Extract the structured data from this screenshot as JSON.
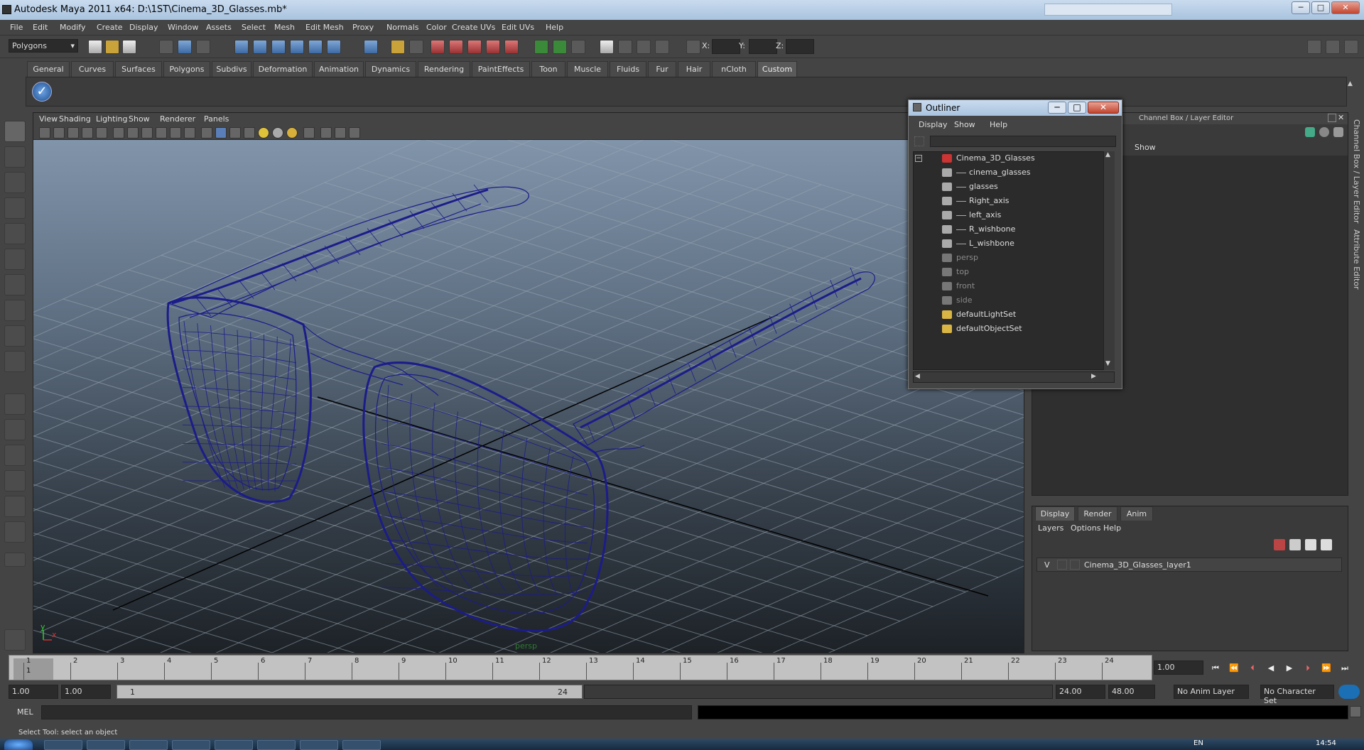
{
  "window": {
    "title": "Autodesk Maya 2011 x64: D:\\1ST\\Cinema_3D_Glasses.mb*",
    "minimize": "─",
    "maximize": "□",
    "close": "✕"
  },
  "menubar": [
    "File",
    "Edit",
    "Modify",
    "Create",
    "Display",
    "Window",
    "Assets",
    "Select",
    "Mesh",
    "Edit Mesh",
    "Proxy",
    "Normals",
    "Color",
    "Create UVs",
    "Edit UVs",
    "Help"
  ],
  "statusline": {
    "mode": "Polygons",
    "x_label": "X:",
    "y_label": "Y:",
    "z_label": "Z:"
  },
  "shelf_tabs": [
    "General",
    "Curves",
    "Surfaces",
    "Polygons",
    "Subdivs",
    "Deformation",
    "Animation",
    "Dynamics",
    "Rendering",
    "PaintEffects",
    "Toon",
    "Muscle",
    "Fluids",
    "Fur",
    "Hair",
    "nCloth",
    "Custom"
  ],
  "shelf_active": "Custom",
  "viewport": {
    "menu": [
      "View",
      "Shading",
      "Lighting",
      "Show",
      "Renderer",
      "Panels"
    ],
    "camera_label": "persp",
    "axis_y": "y",
    "axis_x": "x",
    "wire_color": "#1c1c8a"
  },
  "outliner": {
    "title": "Outliner",
    "menu": [
      "Display",
      "Show",
      "Help"
    ],
    "items": [
      {
        "label": "Cinema_3D_Glasses",
        "depth": 0,
        "dim": false,
        "icon": "group-icon"
      },
      {
        "label": "cinema_glasses",
        "depth": 1,
        "dim": false,
        "icon": "mesh-icon"
      },
      {
        "label": "glasses",
        "depth": 1,
        "dim": false,
        "icon": "mesh-icon"
      },
      {
        "label": "Right_axis",
        "depth": 1,
        "dim": false,
        "icon": "mesh-icon"
      },
      {
        "label": "left_axis",
        "depth": 1,
        "dim": false,
        "icon": "mesh-icon"
      },
      {
        "label": "R_wishbone",
        "depth": 1,
        "dim": false,
        "icon": "mesh-icon"
      },
      {
        "label": "L_wishbone",
        "depth": 1,
        "dim": false,
        "icon": "mesh-icon"
      },
      {
        "label": "persp",
        "depth": 0,
        "dim": true,
        "icon": "camera-icon"
      },
      {
        "label": "top",
        "depth": 0,
        "dim": true,
        "icon": "camera-icon"
      },
      {
        "label": "front",
        "depth": 0,
        "dim": true,
        "icon": "camera-icon"
      },
      {
        "label": "side",
        "depth": 0,
        "dim": true,
        "icon": "camera-icon"
      },
      {
        "label": "defaultLightSet",
        "depth": 0,
        "dim": false,
        "icon": "set-icon"
      },
      {
        "label": "defaultObjectSet",
        "depth": 0,
        "dim": false,
        "icon": "set-icon"
      }
    ]
  },
  "channel_box": {
    "title": "Channel Box / Layer Editor",
    "show": "Show",
    "side_tab_1": "Channel Box / Layer Editor",
    "side_tab_2": "Attribute Editor"
  },
  "layer_editor": {
    "tabs": [
      "Display",
      "Render",
      "Anim"
    ],
    "menu": [
      "Layers",
      "Options",
      "Help"
    ],
    "layer": {
      "visible": "V",
      "name": "Cinema_3D_Glasses_layer1"
    }
  },
  "timeline": {
    "ticks": [
      "1",
      "2",
      "3",
      "4",
      "5",
      "6",
      "7",
      "8",
      "9",
      "10",
      "11",
      "12",
      "13",
      "14",
      "15",
      "16",
      "17",
      "18",
      "19",
      "20",
      "21",
      "22",
      "23",
      "24"
    ],
    "current_frame": "1",
    "current_time": "1.00"
  },
  "range": {
    "start": "1.00",
    "playback_start": "1.00",
    "slider_start": "1",
    "slider_end": "24",
    "playback_end": "24.00",
    "end": "48.00",
    "anim_layer": "No Anim Layer",
    "character_set": "No Character Set"
  },
  "command": {
    "label": "MEL"
  },
  "help_line": "Select Tool: select an object",
  "taskbar": {
    "time": "14:54",
    "lang": "EN"
  }
}
